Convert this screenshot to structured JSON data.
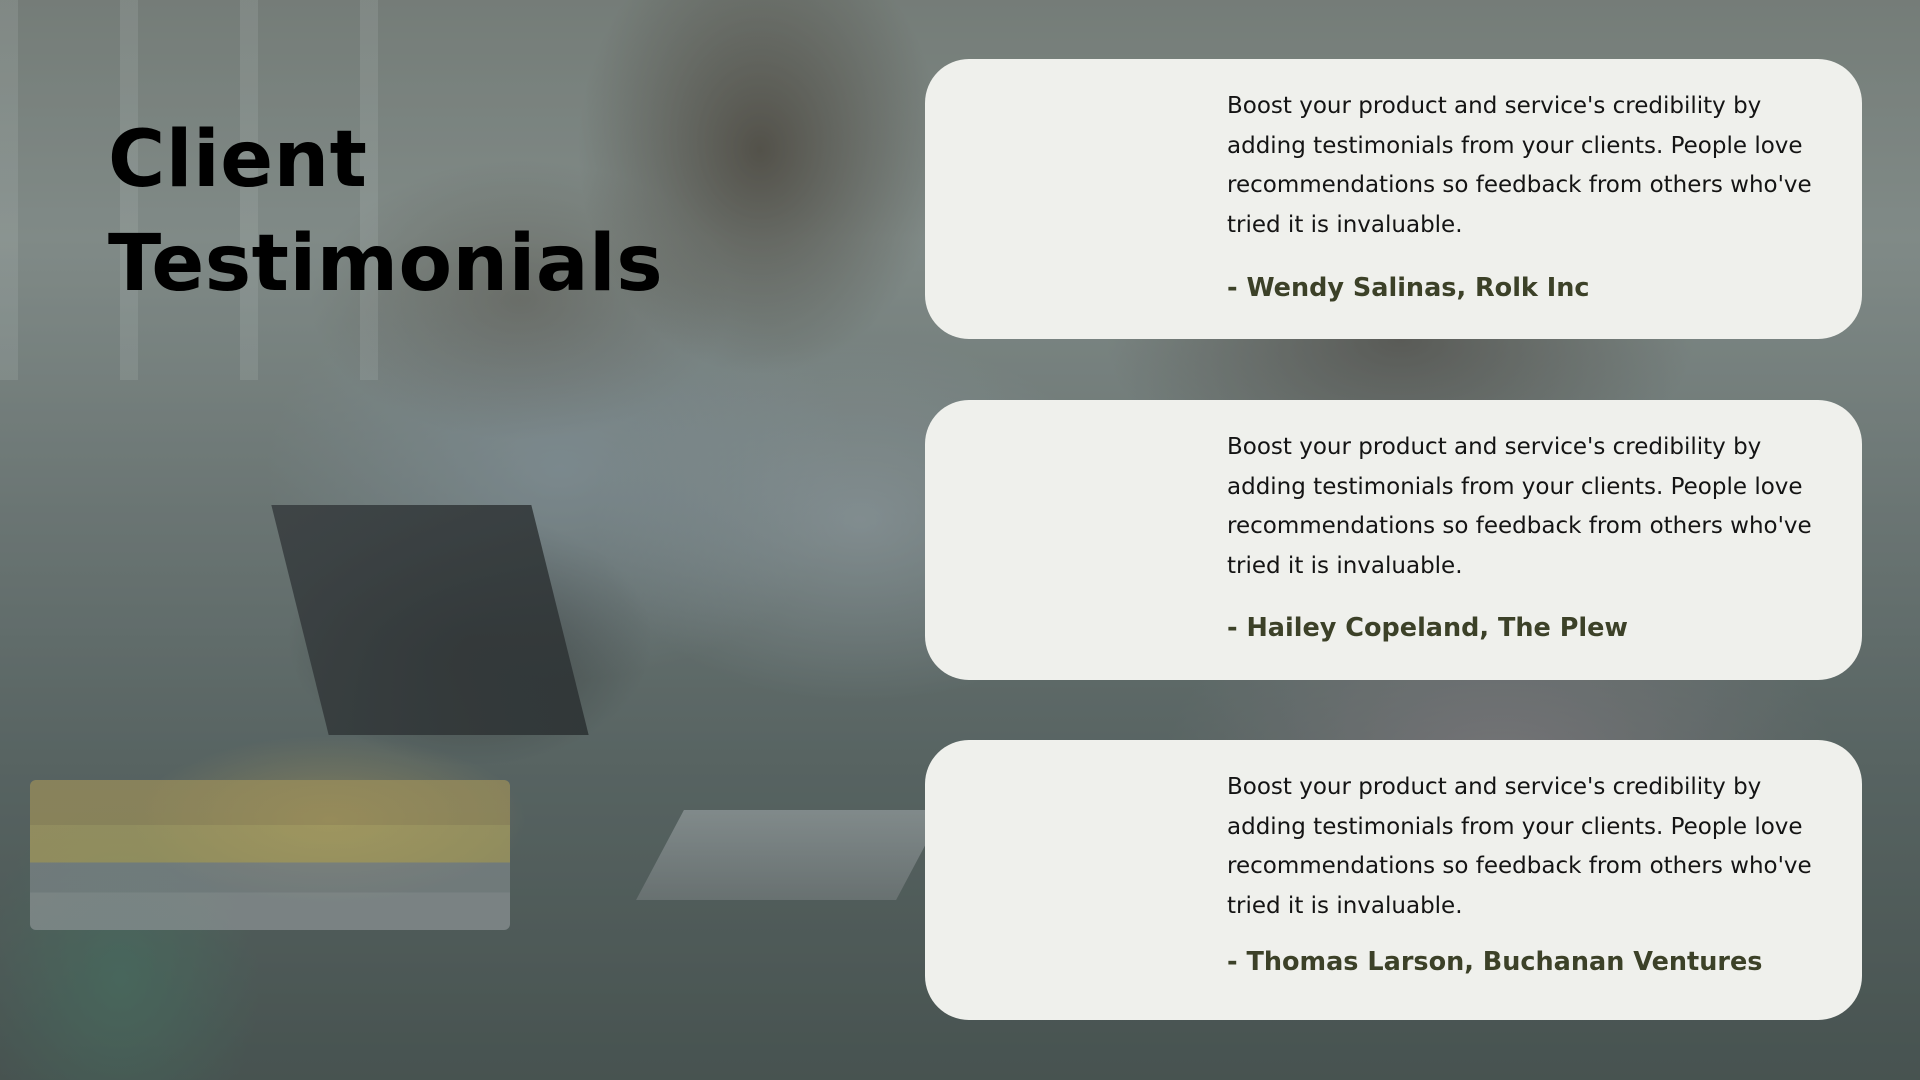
{
  "heading": {
    "line1": "Client",
    "line2": "Testimonials"
  },
  "testimonials": [
    {
      "quote": "Boost your product and service's credibility by adding testimonials from your clients. People love recommendations so feedback from others who've tried it is invaluable.",
      "author": "- Wendy Salinas, Rolk Inc"
    },
    {
      "quote": "Boost your product and service's credibility by adding testimonials from your clients. People love recommendations so feedback from others who've tried it is invaluable.",
      "author": "- Hailey Copeland, The Plew"
    },
    {
      "quote": "Boost your product and service's credibility by adding testimonials from your clients. People love recommendations so feedback from others who've tried it is invaluable.",
      "author": "- Thomas Larson, Buchanan Ventures"
    }
  ],
  "colors": {
    "card_background": "#eff0ec",
    "author_text": "#3c4128",
    "body_text": "#141414",
    "title_text": "#000000"
  }
}
